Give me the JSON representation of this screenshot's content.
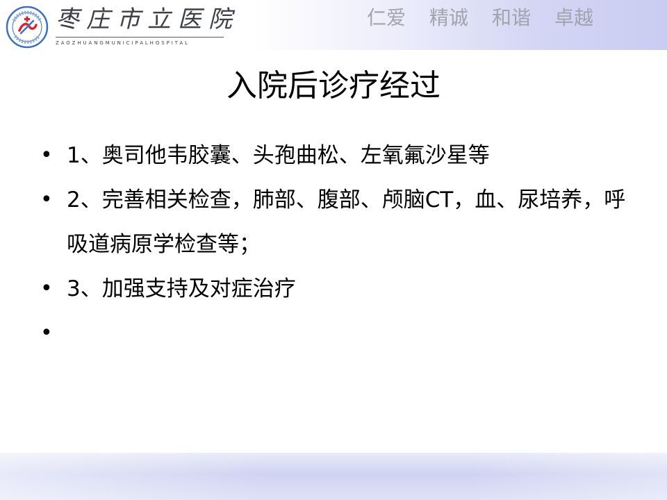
{
  "header": {
    "logo_name": "枣庄市立医院",
    "logo_name_en": "ZAOZHUANGMUNICIPALHOSPITAL",
    "motto": [
      "仁爱",
      "精诚",
      "和谐",
      "卓越"
    ]
  },
  "slide": {
    "title": "入院后诊疗经过",
    "bullets": [
      "1、奥司他韦胶囊、头孢曲松、左氧氟沙星等",
      "2、完善相关检查，肺部、腹部、颅脑CT，血、尿培养，呼吸道病原学检查等；",
      "3、加强支持及对症治疗",
      ""
    ],
    "bullet_glyph": "•"
  },
  "colors": {
    "logo_blue": "#3b6fc0",
    "logo_red": "#d9262c",
    "motto_gray": "#a1a4ad",
    "band_lavender": "#cfd3f2"
  }
}
